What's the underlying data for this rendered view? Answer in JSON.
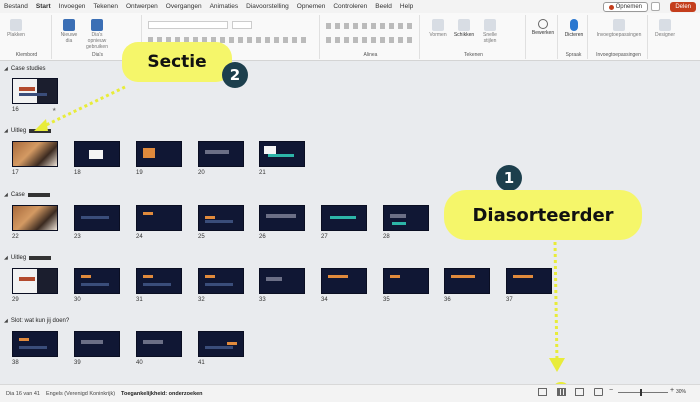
{
  "tabs": [
    "Bestand",
    "Start",
    "Invoegen",
    "Tekenen",
    "Ontwerpen",
    "Overgangen",
    "Animaties",
    "Diavoorstelling",
    "Opnemen",
    "Controleren",
    "Beeld",
    "Help"
  ],
  "active_tab": "Start",
  "header_buttons": {
    "record": "Opnemen",
    "share": "Delen"
  },
  "ribbon": {
    "groups": {
      "clipboard": "Klembord",
      "slides": "Dia's",
      "paragraph": "Alinea",
      "drawing": "Tekenen",
      "voice": "Spraak",
      "designer_group": "Invoegtoepassingen"
    },
    "buttons": {
      "paste": "Plakken",
      "new_slide": "Nieuwe dia",
      "reuse": "Dia's opnieuw gebruiken",
      "shapes": "Vormen",
      "arrange": "Schikken",
      "quick_styles": "Snelle stijlen",
      "edit": "Bewerken",
      "dictate": "Dicteren",
      "addins": "Invoegtoepassingen",
      "designer": "Designer"
    }
  },
  "sections": [
    {
      "title": "Case studies",
      "redacted": false
    },
    {
      "title": "Uitleg",
      "redacted": true
    },
    {
      "title": "Case",
      "redacted": true
    },
    {
      "title": "Uitleg",
      "redacted": true
    },
    {
      "title": "Slot: wat kun jij doen?",
      "redacted": false
    }
  ],
  "slide_numbers": {
    "case_studies": [
      "16"
    ],
    "uitleg1": [
      "17",
      "18",
      "19",
      "20",
      "21"
    ],
    "case": [
      "22",
      "23",
      "24",
      "25",
      "26",
      "27",
      "28"
    ],
    "uitleg2": [
      "29",
      "30",
      "31",
      "32",
      "33",
      "34",
      "35",
      "36",
      "37"
    ],
    "slot": [
      "38",
      "39",
      "40",
      "41"
    ]
  },
  "callouts": {
    "sectie": {
      "label": "Sectie",
      "badge": "2"
    },
    "sorter": {
      "label": "Diasorteerder",
      "badge": "1"
    }
  },
  "status": {
    "slide_count": "Dia 16 van 41",
    "language": "Engels (Verenigd Koninkrijk)",
    "accessibility": "Toegankelijkheid: onderzoeken",
    "zoom": "30%"
  },
  "colors": {
    "accent": "#b7472a",
    "callout": "#f5f66a",
    "badge": "#1d3f4d",
    "slide_bg": "#101734"
  }
}
